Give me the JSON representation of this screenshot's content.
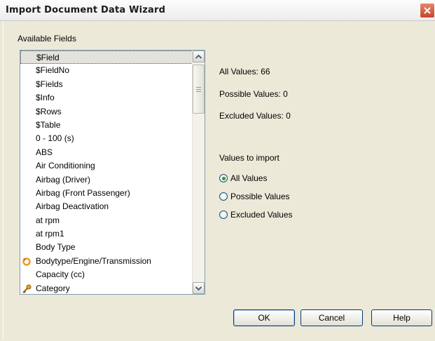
{
  "window": {
    "title": "Import Document Data Wizard"
  },
  "fields": {
    "label": "Available Fields",
    "items": [
      {
        "label": "$Field",
        "selected": true,
        "icon": ""
      },
      {
        "label": "$FieldNo",
        "icon": ""
      },
      {
        "label": "$Fields",
        "icon": ""
      },
      {
        "label": "$Info",
        "icon": ""
      },
      {
        "label": "$Rows",
        "icon": ""
      },
      {
        "label": "$Table",
        "icon": ""
      },
      {
        "label": "0 - 100 (s)",
        "icon": ""
      },
      {
        "label": "ABS",
        "icon": ""
      },
      {
        "label": "Air Conditioning",
        "icon": ""
      },
      {
        "label": "Airbag (Driver)",
        "icon": ""
      },
      {
        "label": "Airbag (Front Passenger)",
        "icon": ""
      },
      {
        "label": "Airbag Deactivation",
        "icon": ""
      },
      {
        "label": "at rpm",
        "icon": ""
      },
      {
        "label": "at rpm1",
        "icon": ""
      },
      {
        "label": "Body Type",
        "icon": ""
      },
      {
        "label": "Bodytype/Engine/Transmission",
        "icon": "cycle-icon"
      },
      {
        "label": "Capacity (cc)",
        "icon": ""
      },
      {
        "label": "Category",
        "icon": "key-icon"
      }
    ]
  },
  "stats": {
    "all": "All Values: 66",
    "possible": "Possible Values: 0",
    "excluded": "Excluded Values: 0"
  },
  "import": {
    "label": "Values to import",
    "options": [
      {
        "label": "All Values",
        "checked": true
      },
      {
        "label": "Possible Values",
        "checked": false
      },
      {
        "label": "Excluded Values",
        "checked": false
      }
    ]
  },
  "buttons": {
    "ok": "OK",
    "cancel": "Cancel",
    "help": "Help"
  },
  "colors": {
    "accent": "#003c74",
    "close": "#c9442a",
    "radio_dot": "#2a9d2a"
  }
}
